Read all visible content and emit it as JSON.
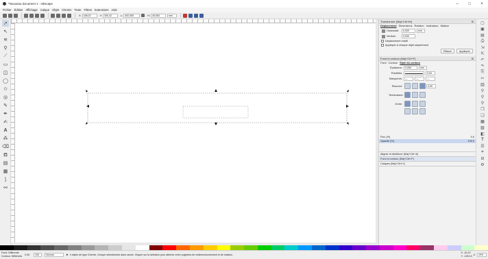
{
  "window": {
    "title": "*Nouveau document 1 - Inkscape",
    "controls": [
      "–",
      "□",
      "×"
    ]
  },
  "menu": [
    "Fichier",
    "Édition",
    "Affichage",
    "Calque",
    "Objet",
    "Chemin",
    "Texte",
    "Filtres",
    "Extensions",
    "Aide"
  ],
  "toolbar": {
    "x_label": "X:",
    "x_value": "168,02",
    "y_label": "Y:",
    "y_value": "300,42",
    "w_label": "L:",
    "w_value": "392,050",
    "h_label": "H:",
    "h_value": "45,553",
    "unit": "mm"
  },
  "tools": [
    "selector",
    "node",
    "tweak",
    "zoom",
    "measure",
    "rect",
    "3dbox",
    "ellipse",
    "star",
    "spiral",
    "pencil",
    "pen",
    "calligraphy",
    "text",
    "spray",
    "eraser",
    "bucket",
    "gradient",
    "mesh",
    "dropper",
    "connector"
  ],
  "transform_panel": {
    "title": "Transformer (Maj+Ctrl+M)",
    "tabs": [
      "Déplacement",
      "Dimensions",
      "Rotation",
      "Inclinaison",
      "Matrice"
    ],
    "horizontal_label": "Horizontal:",
    "horizontal_value": "0,000",
    "vertical_label": "Vertical:",
    "vertical_value": "0,000",
    "unit": "mm",
    "relative_label": "Déplacement relatif",
    "apply_each_label": "Appliquer à chaque objet séparément",
    "clear_label": "Effacer",
    "apply_label": "Appliquer"
  },
  "fill_stroke_panel": {
    "title": "Fond et contour (Maj+Ctrl+F)",
    "tabs": [
      "Fond",
      "Contour",
      "Style du contour"
    ],
    "width_label": "Épaisseur:",
    "width_value": "0,050",
    "width_unit": "mm",
    "dashes_label": "Pointillés:",
    "dashes_value": "0,00",
    "markers_label": "Marqueurs:",
    "join_label": "Raccord:",
    "join_value": "4,00",
    "cap_label": "Terminaison:",
    "order_label": "Ordre:"
  },
  "blur": {
    "label": "Flou (%)",
    "value": "0,0"
  },
  "opacity": {
    "label": "Opacité (%)",
    "value": "100,0"
  },
  "docked": [
    "Aligner et distribuer (Maj+Ctrl+A)",
    "Fond et contour (Maj+Ctrl+F)",
    "Calques (Maj+Ctrl+L)"
  ],
  "palette_colors": [
    "#000000",
    "#1a1a1a",
    "#333333",
    "#4d4d4d",
    "#666666",
    "#808080",
    "#999999",
    "#b3b3b3",
    "#cccccc",
    "#e6e6e6",
    "#ffffff",
    "#800000",
    "#ff0000",
    "#ff6600",
    "#ff9900",
    "#ffcc00",
    "#ffff00",
    "#99cc00",
    "#66cc00",
    "#00cc00",
    "#00cc66",
    "#00cccc",
    "#0099ff",
    "#0066cc",
    "#0033cc",
    "#3300cc",
    "#6600cc",
    "#9900cc",
    "#cc00cc",
    "#ff00cc",
    "#ff0066",
    "#993366",
    "#ffccee",
    "#ccccff",
    "#ccffcc",
    "#ffffcc"
  ],
  "status": {
    "fill_label": "Fond:",
    "fill_value": "Différents",
    "stroke_label": "Contour:",
    "stroke_value": "Différents",
    "stroke_width": "0,05",
    "opacity_value": "100",
    "layer": "Normal",
    "message": "4 objets de type Chemin, Groupe sélectionnés dans racine. Cliquer sur la sélection pour alterner entre poignées de redimensionnement et de rotation.",
    "x_coord": "X: -61,97",
    "y_coord": "Y: -105,13",
    "zoom_label": "Z:",
    "zoom": "19%"
  }
}
